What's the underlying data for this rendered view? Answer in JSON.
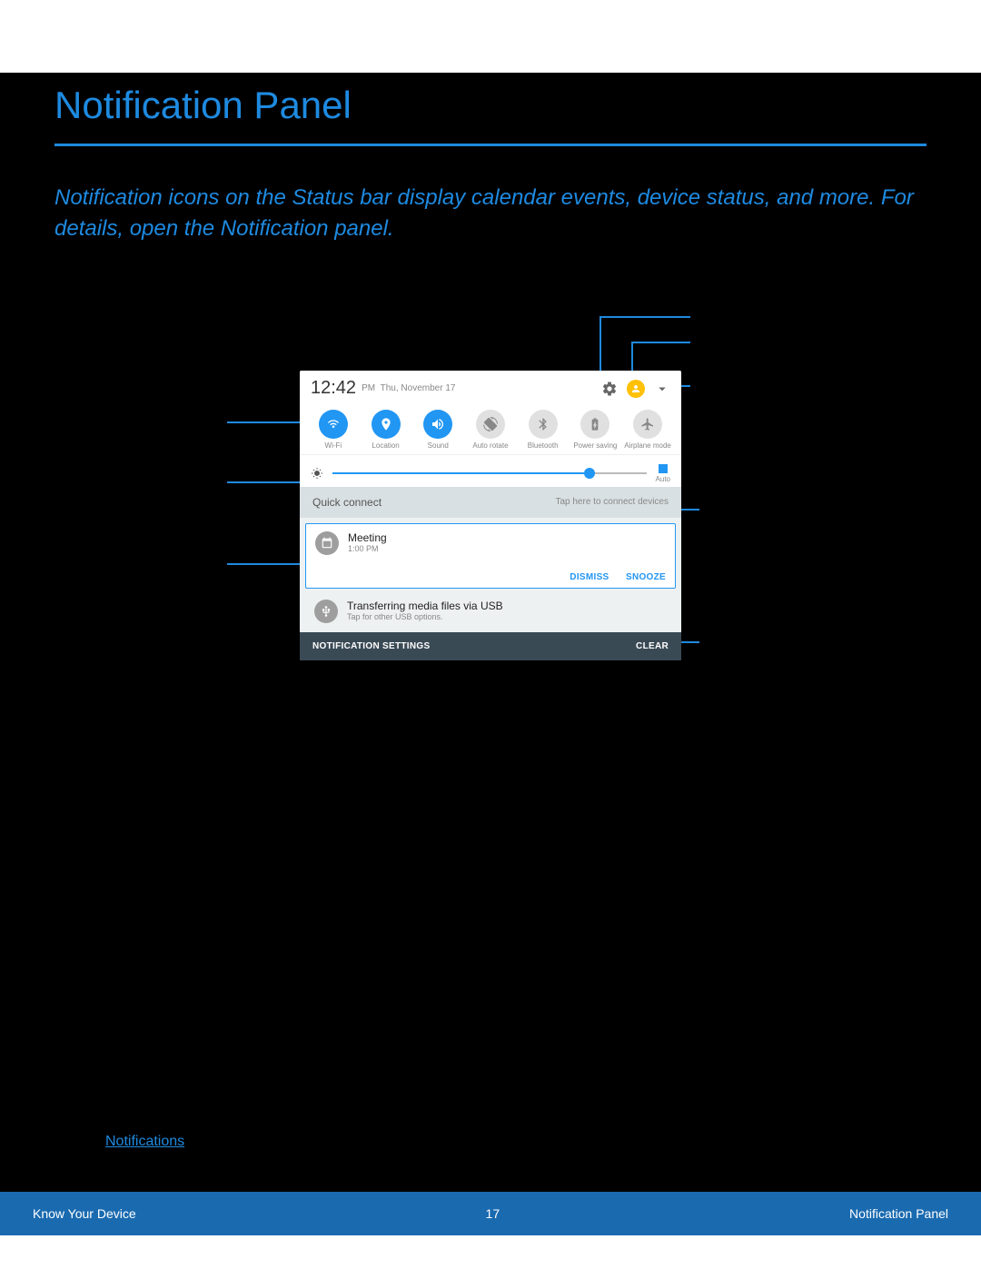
{
  "page": {
    "title": "Notification Panel",
    "intro": "Notification icons on the Status bar display calendar events, device status, and more. For details, open the Notification panel.",
    "link": "Notifications"
  },
  "panel": {
    "time": "12:42",
    "ampm": "PM",
    "date": "Thu, November 17",
    "toggles": [
      {
        "label": "Wi-Fi",
        "on": true
      },
      {
        "label": "Location",
        "on": true
      },
      {
        "label": "Sound",
        "on": true
      },
      {
        "label": "Auto rotate",
        "on": false
      },
      {
        "label": "Bluetooth",
        "on": false
      },
      {
        "label": "Power saving",
        "on": false
      },
      {
        "label": "Airplane mode",
        "on": false
      }
    ],
    "brightness": {
      "auto_label": "Auto"
    },
    "quick_connect": {
      "label": "Quick connect",
      "hint": "Tap here to connect devices"
    },
    "notif1": {
      "title": "Meeting",
      "time": "1:00 PM",
      "dismiss": "DISMISS",
      "snooze": "SNOOZE"
    },
    "notif2": {
      "title": "Transferring media files via USB",
      "sub": "Tap for other USB options."
    },
    "footer": {
      "settings": "NOTIFICATION SETTINGS",
      "clear": "CLEAR"
    }
  },
  "footer": {
    "left": "Know Your Device",
    "center": "17",
    "right": "Notification Panel"
  }
}
